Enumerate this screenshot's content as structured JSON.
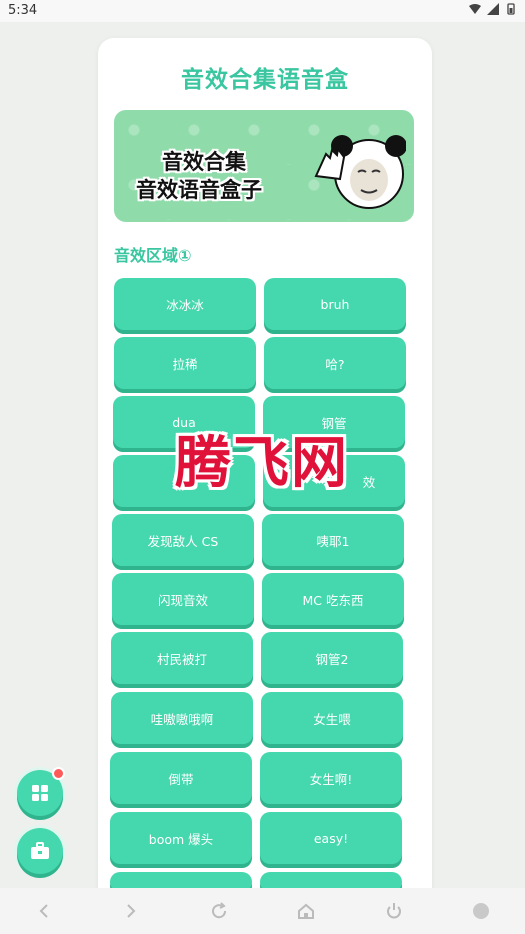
{
  "status_bar": {
    "time": "5:34"
  },
  "app": {
    "title": "音效合集语音盒",
    "banner": {
      "line1": "音效合集",
      "line2": "音效语音盒子"
    },
    "section_label": "音效区域①"
  },
  "buttons": [
    {
      "label": "冰冰冰"
    },
    {
      "label": "bruh"
    },
    {
      "label": "拉稀"
    },
    {
      "label": "哈?"
    },
    {
      "label": "dua"
    },
    {
      "label": "钢管"
    },
    {
      "label": ""
    },
    {
      "label": "效"
    },
    {
      "label": "发现敌人 CS"
    },
    {
      "label": "咦耶1"
    },
    {
      "label": "闪现音效"
    },
    {
      "label": "MC 吃东西"
    },
    {
      "label": "村民被打"
    },
    {
      "label": "钢管2"
    },
    {
      "label": "哇嗷嗷哦啊"
    },
    {
      "label": "女生喂"
    },
    {
      "label": "倒带"
    },
    {
      "label": "女生啊!"
    },
    {
      "label": "boom 爆头"
    },
    {
      "label": "easy!"
    }
  ],
  "watermark": "腾飞网",
  "colors": {
    "accent": "#45d7ad",
    "accent_dark": "#2fb48d",
    "title": "#39c6a0",
    "badge": "#ff5a5a"
  },
  "icons": {
    "fab_top": "grid-apps-icon",
    "fab_bottom": "toolbox-icon",
    "nav": [
      "back-icon",
      "forward-icon",
      "refresh-icon",
      "home-icon",
      "power-icon",
      "circle-icon"
    ]
  }
}
